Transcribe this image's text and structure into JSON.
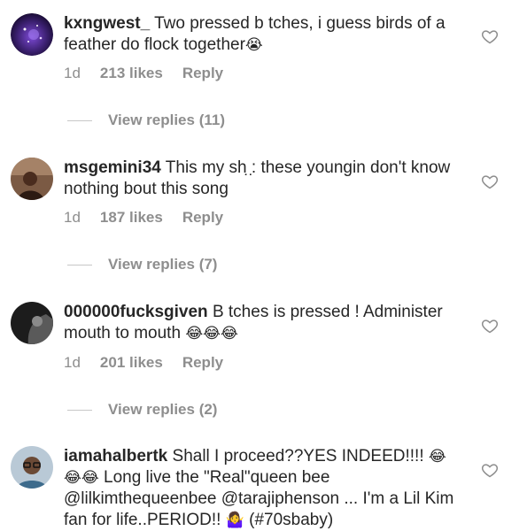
{
  "comments": [
    {
      "username": "kxngwest_",
      "text": "Two pressed b tches, i guess birds of a feather do flock together",
      "emoji": "😭",
      "time": "1d",
      "likes": "213 likes",
      "reply": "Reply",
      "view_replies": "View replies (11)",
      "avatar_icon": "galaxy-avatar-icon",
      "avatar_color": "#3a1f6e"
    },
    {
      "username": "msgemini34",
      "text": "This my sh ̣:̣ these youngin don't know nothing bout this song",
      "time": "1d",
      "likes": "187 likes",
      "reply": "Reply",
      "view_replies": "View replies (7)",
      "avatar_icon": "person-photo-avatar-icon",
      "avatar_color": "#5b3a2a"
    },
    {
      "username": "000000fucksgiven",
      "text": "B tches is pressed ! Administer mouth to mouth",
      "emoji": "😂😂😂",
      "time": "1d",
      "likes": "201 likes",
      "reply": "Reply",
      "view_replies": "View replies (2)",
      "avatar_icon": "dark-photo-avatar-icon",
      "avatar_color": "#1c1c1c"
    },
    {
      "username": "iamahalbertk",
      "text_1": "Shall I proceed??YES INDEED!!!!",
      "emoji_1": "😂😂😂",
      "text_2": "Long live the \"Real\"queen bee @lilkimthequeenbee @tarajiphenson ... I'm a Lil Kim fan for life..PERIOD!!",
      "emoji_2": "🤷‍♀️",
      "text_3": "(#70sbaby)",
      "avatar_icon": "glasses-person-avatar-icon",
      "avatar_color": "#b9c9d6"
    }
  ],
  "icons": {
    "like": "heart-outline-icon"
  },
  "colors": {
    "text": "#262626",
    "muted": "#8e8e8e",
    "divider": "#c7c7c7"
  }
}
